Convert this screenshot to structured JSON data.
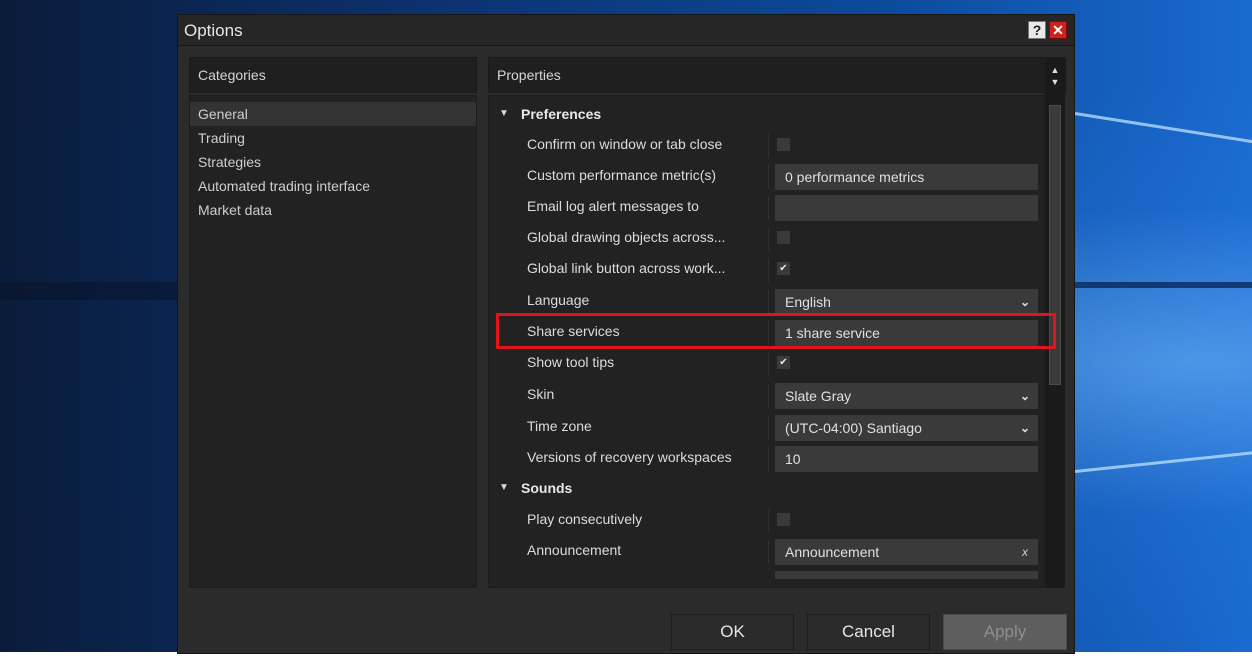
{
  "window": {
    "title": "Options",
    "help_icon": "?",
    "close_icon": "✕"
  },
  "categories": {
    "header": "Categories",
    "items": [
      {
        "label": "General",
        "selected": true
      },
      {
        "label": "Trading"
      },
      {
        "label": "Strategies"
      },
      {
        "label": "Automated trading interface"
      },
      {
        "label": "Market data"
      }
    ]
  },
  "properties": {
    "header": "Properties",
    "sections": [
      {
        "title": "Preferences"
      },
      {
        "title": "Sounds"
      }
    ],
    "rows": [
      {
        "label": "Confirm on window or tab close",
        "type": "checkbox",
        "checked": false
      },
      {
        "label": "Custom performance metric(s)",
        "type": "text",
        "value": "0 performance metrics"
      },
      {
        "label": "Email log alert messages to",
        "type": "text",
        "value": ""
      },
      {
        "label": "Global drawing objects across...",
        "type": "checkbox",
        "checked": false
      },
      {
        "label": "Global link button across work...",
        "type": "checkbox",
        "checked": true,
        "mark": "✔"
      },
      {
        "label": "Language",
        "type": "select",
        "value": "English"
      },
      {
        "label": "Share services",
        "type": "text",
        "value": "1 share service",
        "highlighted": true
      },
      {
        "label": "Show tool tips",
        "type": "checkbox",
        "checked": true,
        "mark": "✔"
      },
      {
        "label": "Skin",
        "type": "select",
        "value": "Slate Gray"
      },
      {
        "label": "Time zone",
        "type": "select",
        "value": "(UTC-04:00) Santiago"
      },
      {
        "label": "Versions of recovery workspaces",
        "type": "text",
        "value": "10"
      },
      {
        "label": "Play consecutively",
        "type": "checkbox",
        "checked": false
      },
      {
        "label": "Announcement",
        "type": "text",
        "value": "Announcement",
        "clear": "x"
      }
    ]
  },
  "buttons": {
    "ok": "OK",
    "cancel": "Cancel",
    "apply": "Apply"
  },
  "icons": {
    "section_toggle": "triangle-down-icon",
    "dropdown": "chevron-down-icon"
  },
  "colors": {
    "highlight": "#e3131b",
    "dialog_bg": "#2b2b2b",
    "close_button": "#d0201c"
  }
}
